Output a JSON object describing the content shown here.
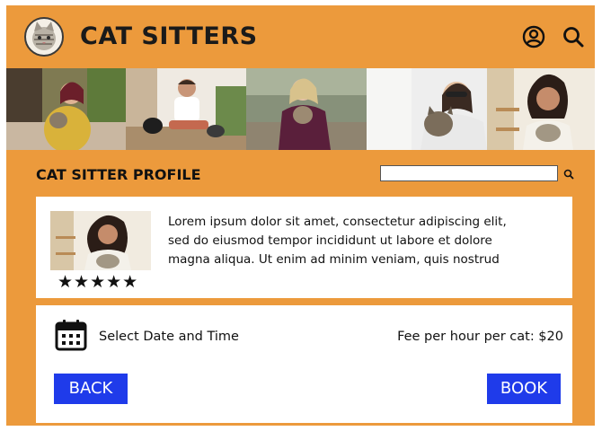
{
  "header": {
    "brand": "CAT SITTERS",
    "logo_icon": "cat-logo-icon",
    "account_icon": "user-circle-icon",
    "search_icon": "search-icon"
  },
  "banner": {
    "photos": [
      "woman-holding-cat-photo",
      "man-sitting-with-cats-photo",
      "woman-hugging-cat-photo",
      "woman-kissing-cat-photo",
      "woman-smiling-with-cat-photo"
    ]
  },
  "profile": {
    "section_title": "CAT SITTER PROFILE",
    "search_placeholder": "",
    "rating_stars": "★★★★★",
    "rating": 5,
    "bio_line1": "Lorem ipsum dolor sit amet, consectetur adipiscing elit,",
    "bio_line2": "sed do eiusmod tempor incididunt ut labore et dolore",
    "bio_line3": "magna aliqua. Ut enim ad minim veniam, quis nostrud"
  },
  "booking": {
    "calendar_icon": "calendar-icon",
    "select_label": "Select Date and Time",
    "fee_label": "Fee per hour per cat: $20",
    "back_label": "BACK",
    "book_label": "BOOK"
  },
  "colors": {
    "background": "#ec9a3c",
    "button": "#1f3bea",
    "card": "#ffffff"
  }
}
